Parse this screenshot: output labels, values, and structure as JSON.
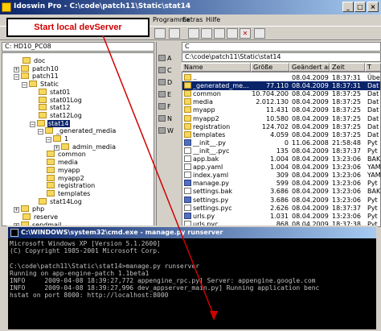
{
  "window": {
    "title": "Idoswin Pro - C:\\code\\patch11\\Static\\stat14",
    "min": "_",
    "max": "□",
    "close": "×"
  },
  "menu": [
    "Programme",
    "Extras",
    "Hilfe"
  ],
  "callout": "Start local devServer",
  "left_drive": "C: HD10_PC08",
  "right_drive": "C",
  "tree": [
    {
      "label": "doc",
      "expander": "",
      "depth": 1
    },
    {
      "label": "patch10",
      "expander": "+",
      "depth": 1
    },
    {
      "label": "patch11",
      "expander": "−",
      "depth": 1
    },
    {
      "label": "Static",
      "expander": "−",
      "depth": 2
    },
    {
      "label": "stat01",
      "expander": "",
      "depth": 3
    },
    {
      "label": "stat01Log",
      "expander": "",
      "depth": 3
    },
    {
      "label": "stat12",
      "expander": "",
      "depth": 3
    },
    {
      "label": "stat12Log",
      "expander": "",
      "depth": 3
    },
    {
      "label": "stat14",
      "expander": "−",
      "depth": 3,
      "selected": true
    },
    {
      "label": "_generated_media",
      "expander": "−",
      "depth": 4
    },
    {
      "label": "1",
      "expander": "−",
      "depth": 5
    },
    {
      "label": "admin_media",
      "expander": "+",
      "depth": 6
    },
    {
      "label": "common",
      "expander": "",
      "depth": 4
    },
    {
      "label": "media",
      "expander": "",
      "depth": 4
    },
    {
      "label": "myapp",
      "expander": "",
      "depth": 4
    },
    {
      "label": "myapp2",
      "expander": "",
      "depth": 4
    },
    {
      "label": "registration",
      "expander": "",
      "depth": 4
    },
    {
      "label": "templates",
      "expander": "",
      "depth": 4
    },
    {
      "label": "stat14Log",
      "expander": "",
      "depth": 3
    },
    {
      "label": "php",
      "expander": "+",
      "depth": 1
    },
    {
      "label": "reserve",
      "expander": "",
      "depth": 1
    },
    {
      "label": "sendmail",
      "expander": "+",
      "depth": 1
    }
  ],
  "drives": [
    "A",
    "C",
    "D",
    "E",
    "F",
    "N",
    "W"
  ],
  "path": "C:\\code\\patch11\\Static\\stat14",
  "columns": [
    "Name",
    "Größe",
    "Geändert am",
    "Zeit",
    "T"
  ],
  "files": [
    {
      "icon": "up",
      "name": "..",
      "size": "",
      "date": "08.04.2009",
      "time": "18:37:31",
      "type": "Übe"
    },
    {
      "icon": "folder",
      "name": "_generated_me...",
      "size": "77.110",
      "date": "08.04.2009",
      "time": "18:37:31",
      "type": "Dat",
      "selected": true
    },
    {
      "icon": "folder",
      "name": "common",
      "size": "10.704.200",
      "date": "08.04.2009",
      "time": "18:37:25",
      "type": "Dat"
    },
    {
      "icon": "folder",
      "name": "media",
      "size": "2.012.130",
      "date": "08.04.2009",
      "time": "18:37:25",
      "type": "Dat"
    },
    {
      "icon": "folder",
      "name": "myapp",
      "size": "11.431",
      "date": "08.04.2009",
      "time": "18:37:25",
      "type": "Dat"
    },
    {
      "icon": "folder",
      "name": "myapp2",
      "size": "10.580",
      "date": "08.04.2009",
      "time": "18:37:25",
      "type": "Dat"
    },
    {
      "icon": "folder",
      "name": "registration",
      "size": "124.702",
      "date": "08.04.2009",
      "time": "18:37:25",
      "type": "Dat"
    },
    {
      "icon": "folder",
      "name": "templates",
      "size": "4.059",
      "date": "08.04.2009",
      "time": "18:37:25",
      "type": "Dat"
    },
    {
      "icon": "py",
      "name": "__init__.py",
      "size": "0",
      "date": "11.06.2008",
      "time": "21:58:48",
      "type": "Pyt"
    },
    {
      "icon": "file",
      "name": "__init__.pyc",
      "size": "135",
      "date": "08.04.2009",
      "time": "18:37:37",
      "type": "Pyt"
    },
    {
      "icon": "file",
      "name": "app.bak",
      "size": "1.004",
      "date": "08.04.2009",
      "time": "13:23:06",
      "type": "BAK"
    },
    {
      "icon": "file",
      "name": "app.yaml",
      "size": "1.004",
      "date": "08.04.2009",
      "time": "13:23:06",
      "type": "YAM"
    },
    {
      "icon": "file",
      "name": "index.yaml",
      "size": "309",
      "date": "08.04.2009",
      "time": "13:23:06",
      "type": "YAM"
    },
    {
      "icon": "py",
      "name": "manage.py",
      "size": "599",
      "date": "08.04.2009",
      "time": "13:23:06",
      "type": "Pyt"
    },
    {
      "icon": "file",
      "name": "settings.bak",
      "size": "3.686",
      "date": "08.04.2009",
      "time": "13:23:06",
      "type": "BAK"
    },
    {
      "icon": "py",
      "name": "settings.py",
      "size": "3.686",
      "date": "08.04.2009",
      "time": "13:23:06",
      "type": "Pyt"
    },
    {
      "icon": "file",
      "name": "settings.pyc",
      "size": "2.626",
      "date": "08.04.2009",
      "time": "18:37:37",
      "type": "Pyt"
    },
    {
      "icon": "py",
      "name": "urls.py",
      "size": "1.031",
      "date": "08.04.2009",
      "time": "13:23:06",
      "type": "Pyt"
    },
    {
      "icon": "file",
      "name": "urls.pyc",
      "size": "868",
      "date": "08.04.2009",
      "time": "18:37:38",
      "type": "Pyt"
    }
  ],
  "console": {
    "title": "C:\\WINDOWS\\system32\\cmd.exe - manage.py runserver",
    "lines": [
      "Microsoft Windows XP [Version 5.1.2600]",
      "(C) Copyright 1985-2001 Microsoft Corp.",
      "",
      "C:\\code\\patch11\\Static\\stat14>manage.py runserver",
      "Running on app-engine-patch 1.1beta1",
      "INFO     2009-04-08 18:39:27,772 appengine_rpc.py] Server: appengine.google.com",
      "INFO     2009-04-08 18:39:27,996 dev_appserver_main.py] Running application benc",
      "hstat on port 8000: http://localhost:8000"
    ]
  }
}
